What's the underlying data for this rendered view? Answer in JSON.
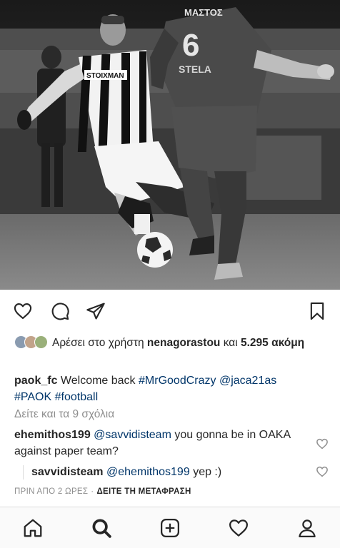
{
  "likes": {
    "prefix": "Αρέσει στο χρήστη",
    "user": "nenagorastou",
    "middle": "και",
    "count": "5.295",
    "suffix": "ακόμη"
  },
  "caption": {
    "username": "paok_fc",
    "text": "Welcome back",
    "hashtag1": "#MrGoodCrazy",
    "mention": "@jaca21as",
    "hashtag2": "#PAOK",
    "hashtag3": "#football"
  },
  "view_all_comments": "Δείτε και τα 9 σχόλια",
  "comments": [
    {
      "username": "ehemithos199",
      "mention": "@savvidisteam",
      "text": "you gonna be in OAKA against paper team?"
    },
    {
      "username": "savvidisteam",
      "mention": "@ehemithos199",
      "text": "yep :)"
    }
  ],
  "timestamp": "ΠΡΙΝ ΑΠΟ 2 ΩΡΕΣ",
  "separator": "·",
  "translate": "ΔΕΙΤΕ ΤΗ ΜΕΤΑΦΡΑΣΗ",
  "photo": {
    "jersey_number": "6",
    "jersey_name": "ΜΑΣΤΟΣ",
    "sponsor": "STOIXMAN"
  },
  "colors": {
    "link": "#003569",
    "secondary_text": "#8e8e8e",
    "text": "#262626"
  },
  "icons": [
    "heart-icon",
    "comment-icon",
    "share-icon",
    "bookmark-icon",
    "home-icon",
    "search-icon",
    "add-post-icon",
    "activity-heart-icon",
    "profile-icon"
  ]
}
